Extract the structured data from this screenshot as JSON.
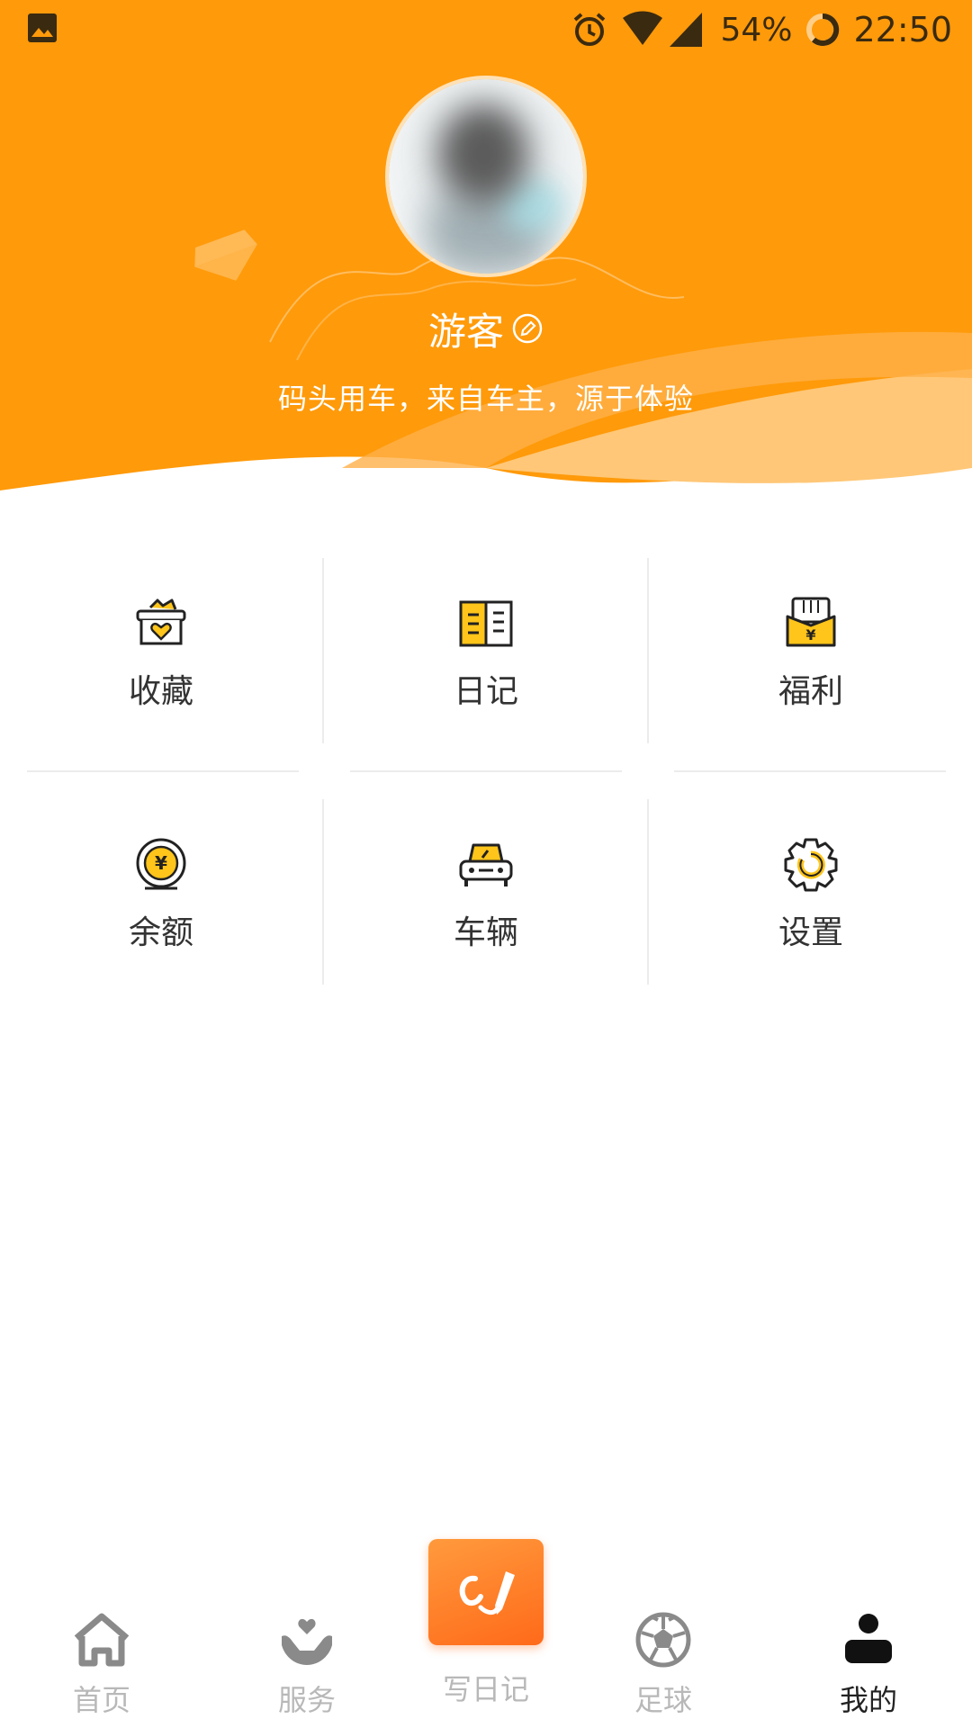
{
  "status_bar": {
    "battery": "54%",
    "time": "22:50"
  },
  "profile": {
    "username": "游客",
    "tagline": "码头用车，来自车主，源于体验"
  },
  "grid": [
    {
      "label": "收藏",
      "icon": "favorites-basket-icon"
    },
    {
      "label": "日记",
      "icon": "diary-book-icon"
    },
    {
      "label": "福利",
      "icon": "welfare-envelope-icon"
    },
    {
      "label": "余额",
      "icon": "balance-coin-icon"
    },
    {
      "label": "车辆",
      "icon": "vehicle-car-icon"
    },
    {
      "label": "设置",
      "icon": "settings-gear-icon"
    }
  ],
  "nav": {
    "home": "首页",
    "service": "服务",
    "write": "写日记",
    "football": "足球",
    "mine": "我的",
    "active": "mine"
  },
  "colors": {
    "brand_orange": "#ff9a0a",
    "icon_yellow": "#ffc51a",
    "active_text": "#222222",
    "inactive_text": "#b8b8b8"
  }
}
